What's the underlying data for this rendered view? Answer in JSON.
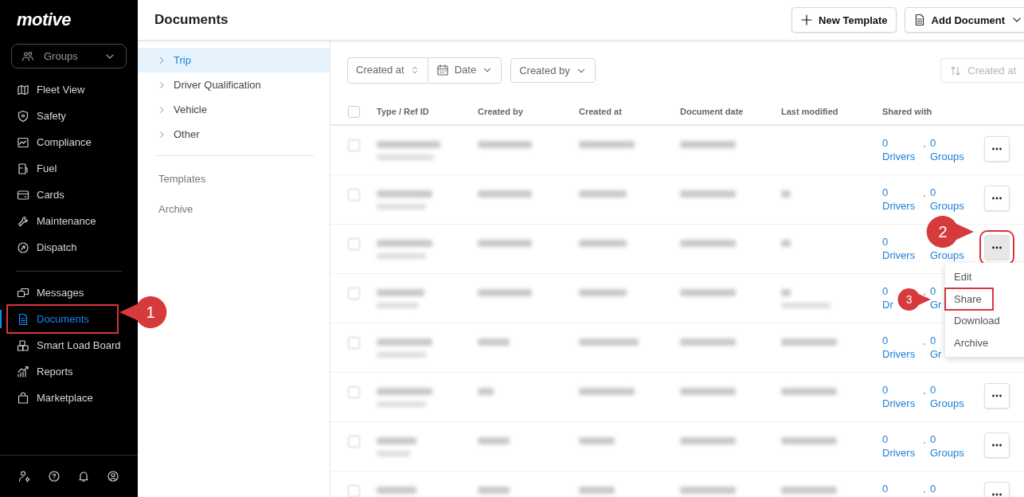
{
  "sidebar": {
    "logo": "motive",
    "groups_select": {
      "label": "Groups"
    },
    "sections": [
      [
        {
          "label": "Fleet View",
          "selected": false
        },
        {
          "label": "Safety",
          "selected": false
        },
        {
          "label": "Compliance",
          "selected": false
        },
        {
          "label": "Fuel",
          "selected": false
        },
        {
          "label": "Cards",
          "selected": false
        },
        {
          "label": "Maintenance",
          "selected": false
        },
        {
          "label": "Dispatch",
          "selected": false
        }
      ],
      [
        {
          "label": "Messages",
          "selected": false
        },
        {
          "label": "Documents",
          "selected": true,
          "highlighted": true
        },
        {
          "label": "Smart Load Board",
          "selected": false
        },
        {
          "label": "Reports",
          "selected": false
        },
        {
          "label": "Marketplace",
          "selected": false
        }
      ]
    ]
  },
  "header": {
    "title": "Documents",
    "buttons": [
      {
        "label": "New Template",
        "kind": "plus"
      },
      {
        "label": "Add Document",
        "kind": "dropdown"
      }
    ]
  },
  "subnav": {
    "categories": [
      {
        "label": "Trip",
        "selected": true
      },
      {
        "label": "Driver Qualification",
        "selected": false
      },
      {
        "label": "Vehicle",
        "selected": false
      },
      {
        "label": "Other",
        "selected": false
      }
    ],
    "links": [
      {
        "label": "Templates"
      },
      {
        "label": "Archive"
      }
    ]
  },
  "filters": {
    "sort_field": "Created at",
    "date": "Date",
    "created_by": "Created by",
    "sort": {
      "label": "Created at",
      "disabled": true
    }
  },
  "table": {
    "columns": [
      "Type / Ref ID",
      "Created by",
      "Created at",
      "Document date",
      "Last modified",
      "Shared with"
    ],
    "header_checked": false,
    "rows": [
      {
        "checked": false,
        "drivers_count": "0",
        "drivers_label": "Drivers",
        "groups_count": "0",
        "groups_label": "Groups",
        "menu_button": true
      },
      {
        "checked": false,
        "drivers_count": "0",
        "drivers_label": "Drivers",
        "groups_count": "0",
        "groups_label": "Groups",
        "menu_button": true
      },
      {
        "checked": false,
        "drivers_count": "0",
        "drivers_label": "Drivers",
        "groups_label": "Groups",
        "menu_button": true,
        "pressed": true,
        "highlighted": true
      },
      {
        "checked": false,
        "drivers_count": "0",
        "drivers_label": "Dr",
        "groups_count": "0",
        "groups_label": "Gr",
        "menu_button": false
      },
      {
        "checked": false,
        "drivers_count": "0",
        "drivers_label": "Drivers",
        "groups_count": "0",
        "groups_label": "Gr",
        "menu_button": false
      },
      {
        "checked": false,
        "drivers_count": "0",
        "drivers_label": "Drivers",
        "groups_count": "0",
        "groups_label": "Groups",
        "menu_button": true
      },
      {
        "checked": false,
        "drivers_count": "0",
        "drivers_label": "Drivers",
        "groups_count": "0",
        "groups_label": "Groups",
        "menu_button": true
      },
      {
        "checked": false,
        "drivers_count": "0",
        "groups_count": "0",
        "menu_button": true
      }
    ]
  },
  "row_menu": {
    "items": [
      {
        "label": "Edit",
        "highlighted": false
      },
      {
        "label": "Share",
        "highlighted": true
      },
      {
        "label": "Download",
        "highlighted": false
      },
      {
        "label": "Archive",
        "highlighted": false
      }
    ]
  },
  "callouts": [
    {
      "label": "1",
      "kind": "left"
    },
    {
      "label": "2",
      "kind": "right"
    },
    {
      "label": "3",
      "kind": "right"
    }
  ]
}
